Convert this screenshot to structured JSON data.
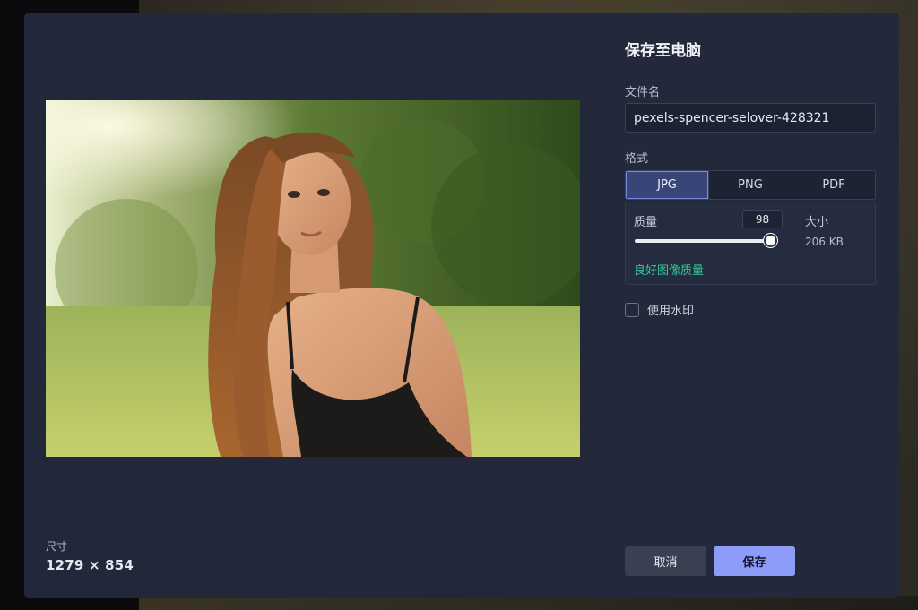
{
  "dialog": {
    "title": "保存至电脑",
    "filename_label": "文件名",
    "filename_value": "pexels-spencer-selover-428321",
    "format_label": "格式",
    "formats": [
      "JPG",
      "PNG",
      "PDF"
    ],
    "selected_format": "JPG",
    "quality": {
      "label": "质量",
      "value": "98",
      "slider_fraction": 0.98,
      "size_label": "大小",
      "size_value": "206 KB",
      "note": "良好图像质量"
    },
    "watermark_label": "使用水印",
    "watermark_checked": false,
    "cancel_label": "取消",
    "save_label": "保存"
  },
  "preview": {
    "dimensions_label": "尺寸",
    "dimensions_value": "1279 × 854"
  },
  "colors": {
    "accent": "#8d9cf8",
    "note_green": "#37c49a",
    "dialog_bg": "#23283a"
  },
  "icons": [
    "checkbox-icon"
  ]
}
